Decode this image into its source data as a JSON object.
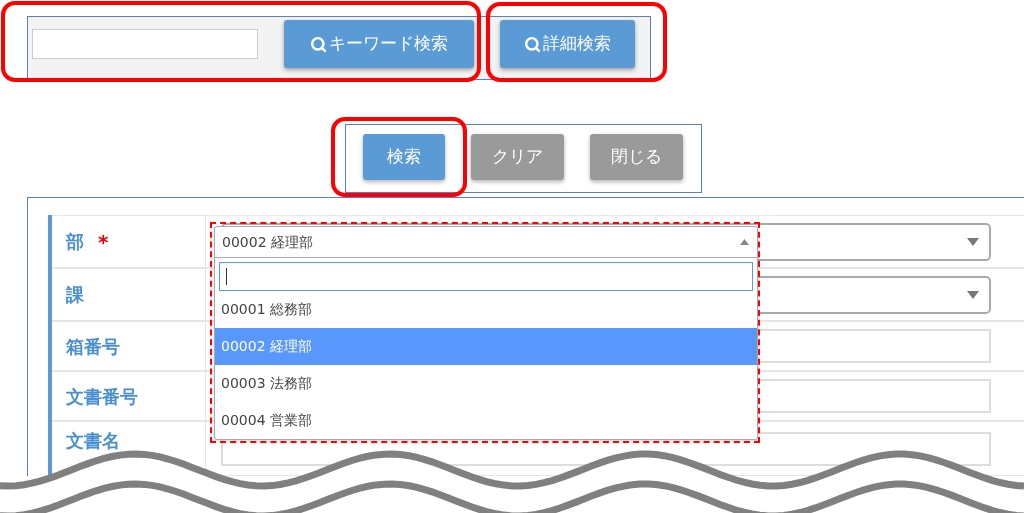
{
  "search_bar": {
    "buttons": [
      {
        "kind": "keyword",
        "label": "キーワード検索"
      },
      {
        "kind": "detail",
        "label": "詳細検索"
      }
    ]
  },
  "actions": [
    {
      "kind": "primary",
      "label": "検索"
    },
    {
      "kind": "secondary",
      "label": "クリア"
    },
    {
      "kind": "secondary",
      "label": "閉じる"
    }
  ],
  "form": {
    "fields": [
      {
        "label": "部",
        "required_mark": "*",
        "kind": "select",
        "dropdown": {
          "value": "00002 経理部",
          "options": [
            {
              "label": "00001 総務部",
              "selected": false
            },
            {
              "label": "00002 経理部",
              "selected": true
            },
            {
              "label": "00003 法務部",
              "selected": false
            },
            {
              "label": "00004 営業部",
              "selected": false
            }
          ]
        }
      },
      {
        "label": "課",
        "kind": "select"
      },
      {
        "label": "箱番号",
        "kind": "text"
      },
      {
        "label": "文書番号",
        "kind": "text"
      },
      {
        "label": "文書名",
        "kind": "text"
      }
    ]
  }
}
